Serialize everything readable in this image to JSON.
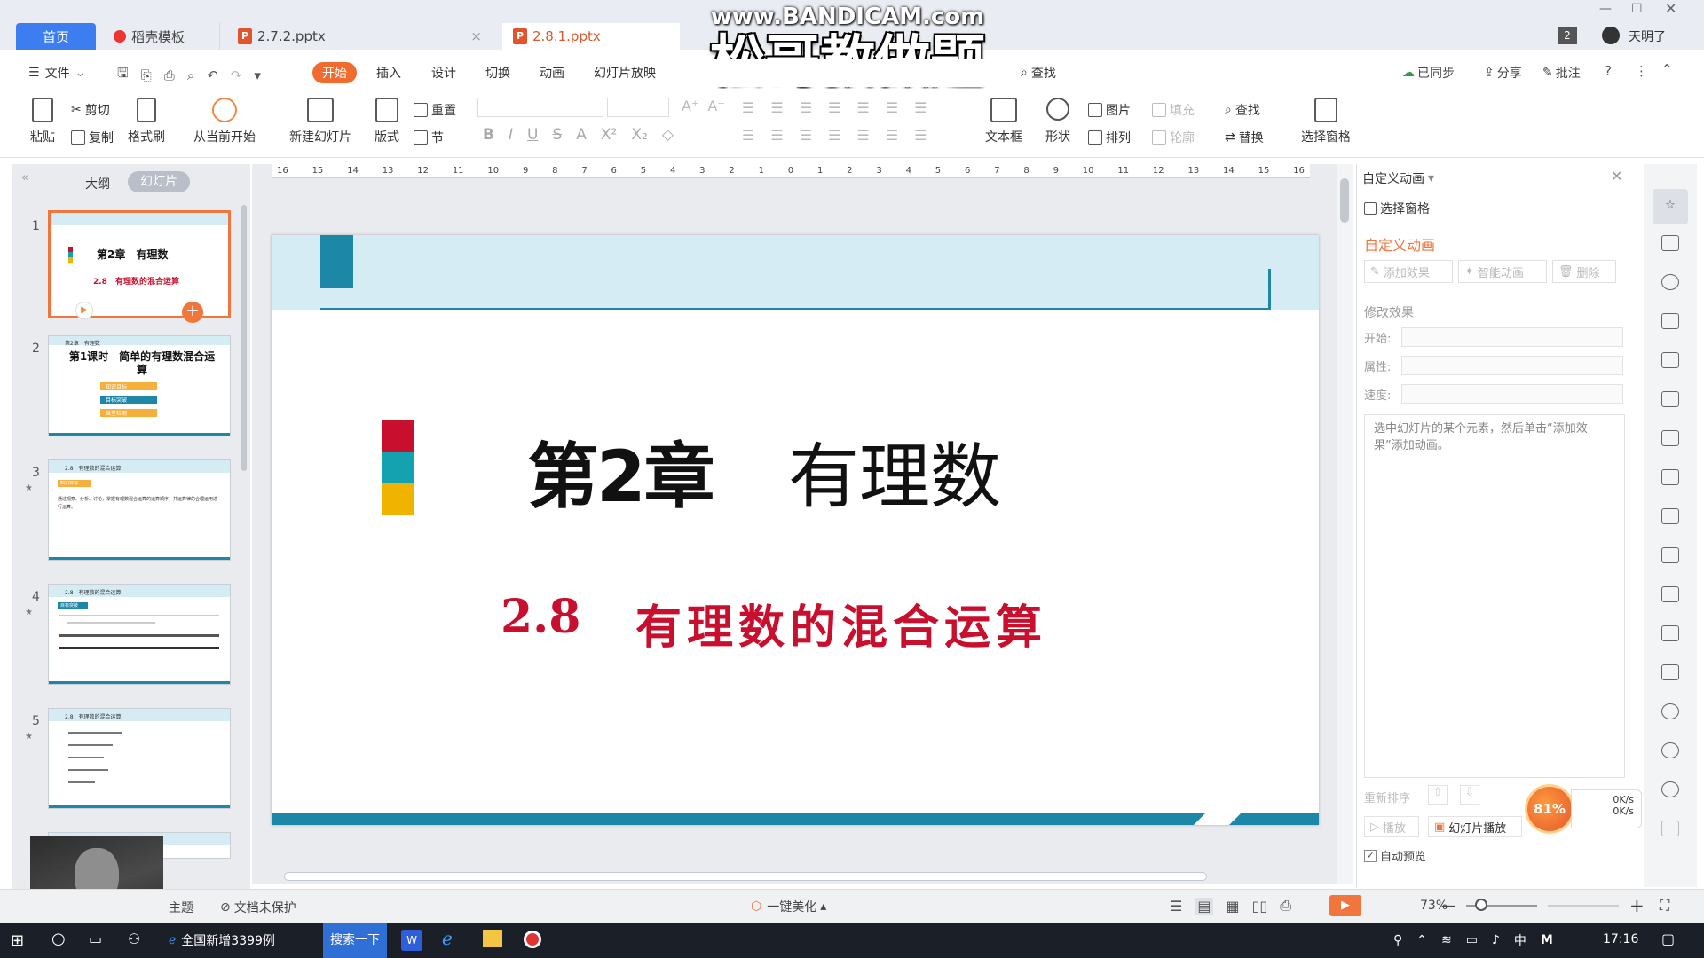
{
  "watermark": {
    "top": "www.BANDICAM.com",
    "main": "松哥教做题"
  },
  "tabs": [
    {
      "label": "首页"
    },
    {
      "label": "稻壳模板"
    },
    {
      "label": "2.7.2.pptx"
    },
    {
      "label": "2.8.1.pptx"
    }
  ],
  "window": {
    "badge": "2",
    "user": "天明了"
  },
  "menu": {
    "file": "文件",
    "items": [
      "开始",
      "插入",
      "设计",
      "切换",
      "动画",
      "幻灯片放映"
    ],
    "search": "查找",
    "sync": "已同步",
    "share": "分享",
    "comment": "批注"
  },
  "ribbon": {
    "paste": "粘贴",
    "cut": "剪切",
    "copy": "复制",
    "format_painter": "格式刷",
    "from_current": "从当前开始",
    "new_slide": "新建幻灯片",
    "layout": "版式",
    "reset": "重置",
    "section": "节",
    "textbox": "文本框",
    "shape": "形状",
    "picture": "图片",
    "fill": "填充",
    "arrange": "排列",
    "outline": "轮廓",
    "find": "查找",
    "replace": "替换",
    "select_pane": "选择窗格"
  },
  "leftpanel": {
    "tab_outline": "大纲",
    "tab_slides": "幻灯片",
    "thumbs": [
      {
        "num": "1",
        "title": "第2章　有理数",
        "sub": "2.8　有理数的混合运算"
      },
      {
        "num": "2",
        "hdr": "第2章　有理数",
        "title": "第1课时　简单的有理数混合运算",
        "items": [
          "知识目标",
          "目标突破",
          "当堂检测"
        ]
      },
      {
        "num": "3",
        "hdr": "2.8　有理数的混合运算",
        "tag": "知识目标",
        "body": "通过观察、分析、讨论，掌握有理数混合运算的运算顺序，并运算律的合理运用进行运算。"
      },
      {
        "num": "4",
        "hdr": "2.8　有理数的混合运算",
        "tag": "目标突破"
      },
      {
        "num": "5",
        "hdr": "2.8　有理数的混合运算"
      }
    ]
  },
  "ruler": {
    "labels": [
      "16",
      "15",
      "14",
      "13",
      "12",
      "11",
      "10",
      "9",
      "8",
      "7",
      "6",
      "5",
      "4",
      "3",
      "2",
      "1",
      "0",
      "1",
      "2",
      "3",
      "4",
      "5",
      "6",
      "7",
      "8",
      "9",
      "10",
      "11",
      "12",
      "13",
      "14",
      "15",
      "16"
    ]
  },
  "slide": {
    "chapter": "第2章",
    "title": "有理数",
    "section_no": "2.8",
    "section_title": "有理数的混合运算",
    "colors": {
      "band": "#d5ecf5",
      "accent": "#1d87a8",
      "red": "#c8102e",
      "teal": "#14a2b0",
      "yellow": "#f0b400"
    }
  },
  "rightpanel": {
    "header": "自定义动画",
    "select_pane": "选择窗格",
    "title": "自定义动画",
    "add_effect": "添加效果",
    "smart": "智能动画",
    "delete": "删除",
    "modify": "修改效果",
    "start": "开始:",
    "property": "属性:",
    "speed": "速度:",
    "hint": "选中幻灯片的某个元素，然后单击“添加效果”添加动画。",
    "reorder": "重新排序",
    "play": "播放",
    "slideshow": "幻灯片播放",
    "autopreview": "自动预览"
  },
  "netmeter": {
    "percent": "81%",
    "up": "0K/s",
    "down": "0K/s"
  },
  "status": {
    "theme": "主题",
    "unprotected": "文档未保护",
    "beautify": "一键美化",
    "zoom": "73%"
  },
  "taskbar": {
    "news": "全国新增3399例",
    "search": "搜索一下",
    "ime": "中",
    "ime2": "M",
    "time": "17:16"
  }
}
